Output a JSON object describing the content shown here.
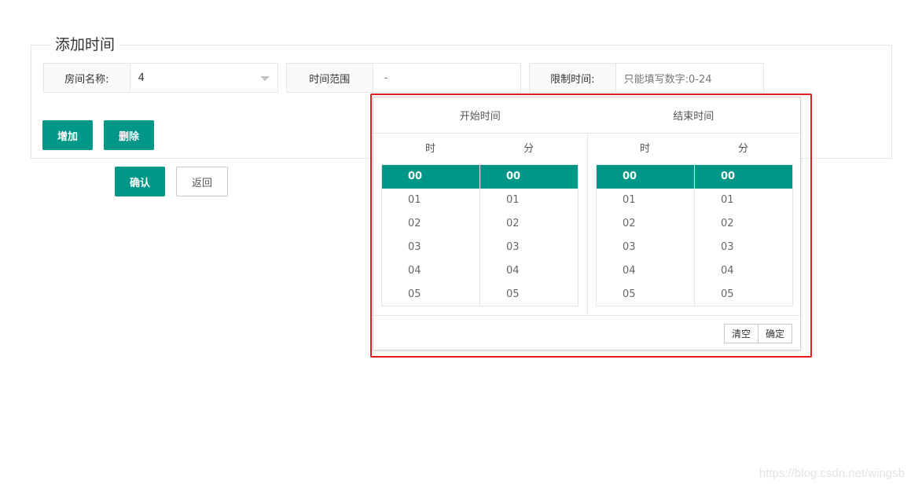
{
  "form": {
    "legend": "添加时间",
    "room_label": "房间名称:",
    "room_value": "4",
    "range_label": "时间范围",
    "range_value": "-",
    "limit_label": "限制时间:",
    "limit_placeholder": "只能填写数字:0-24"
  },
  "buttons": {
    "add": "增加",
    "delete": "删除",
    "confirm": "确认",
    "back": "返回"
  },
  "picker": {
    "start_title": "开始时间",
    "end_title": "结束时间",
    "hour_label": "时",
    "minute_label": "分",
    "items": [
      "00",
      "01",
      "02",
      "03",
      "04",
      "05"
    ],
    "selected_index": 0,
    "clear_label": "清空",
    "ok_label": "确定",
    "frame_color": "#e02020",
    "accent_color": "#009688"
  },
  "watermark": "https://blog.csdn.net/wingsb"
}
